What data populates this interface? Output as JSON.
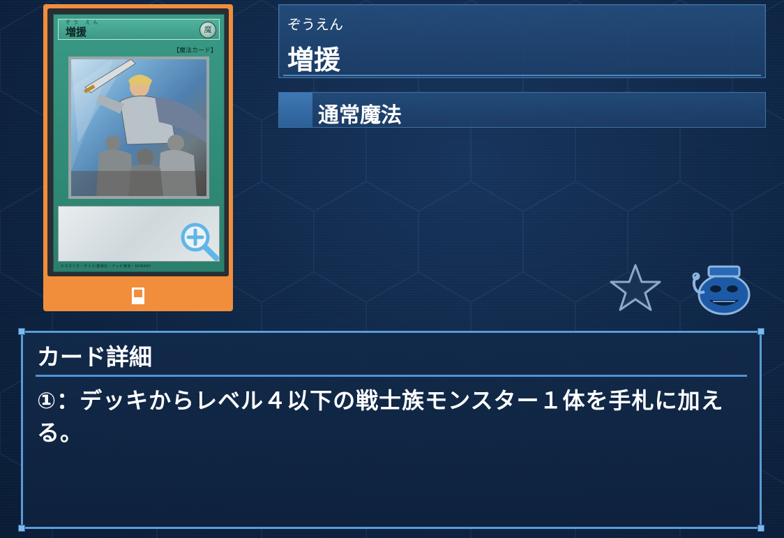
{
  "card": {
    "name_ruby": "ぞう えん",
    "name": "増援",
    "attribute": "魔",
    "type_tag": "【魔法カード】",
    "copyright": "©スタジオ・ダイス/集英社・テレビ東京・KONAMI",
    "zoom_icon": "magnify-plus-icon",
    "footer_icon": "card-icon"
  },
  "header": {
    "ruby": "ぞうえん",
    "name": "増援",
    "card_type": "通常魔法"
  },
  "actions": {
    "favorite_icon": "star-icon",
    "pot_icon": "pot-of-greed-icon"
  },
  "details": {
    "title": "カード詳細",
    "text": "①：デッキからレベル４以下の戦士族モンスター１体を手札に加える。"
  },
  "colors": {
    "background": "#0d2240",
    "card_frame": "#f08e3c",
    "spell_card": "#3a9a85",
    "panel_border": "#5a9cd8"
  }
}
